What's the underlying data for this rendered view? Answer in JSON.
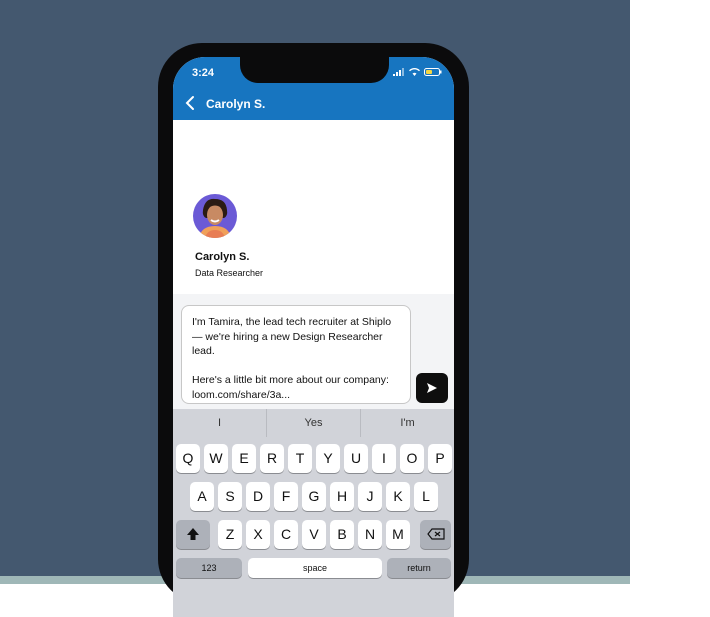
{
  "status_bar": {
    "time": "3:24"
  },
  "header": {
    "contact_name": "Carolyn S."
  },
  "profile": {
    "name": "Carolyn S.",
    "role": "Data Researcher"
  },
  "compose": {
    "message": "I'm Tamira, the lead tech recruiter at Shiplo— we're hiring a new Design Researcher lead.\n\nHere's a little bit more about our company: loom.com/share/3a..."
  },
  "keyboard": {
    "suggestions": [
      "I",
      "Yes",
      "I'm"
    ],
    "row1": [
      "Q",
      "W",
      "E",
      "R",
      "T",
      "Y",
      "U",
      "I",
      "O",
      "P"
    ],
    "row2": [
      "A",
      "S",
      "D",
      "F",
      "G",
      "H",
      "J",
      "K",
      "L"
    ],
    "row3": [
      "Z",
      "X",
      "C",
      "V",
      "B",
      "N",
      "M"
    ],
    "bottom": {
      "numbers": "123",
      "space": "space",
      "return": "return"
    }
  },
  "colors": {
    "header": "#1775c0",
    "backdrop": "#44586f",
    "avatar_bg": "#6b5ad6"
  }
}
